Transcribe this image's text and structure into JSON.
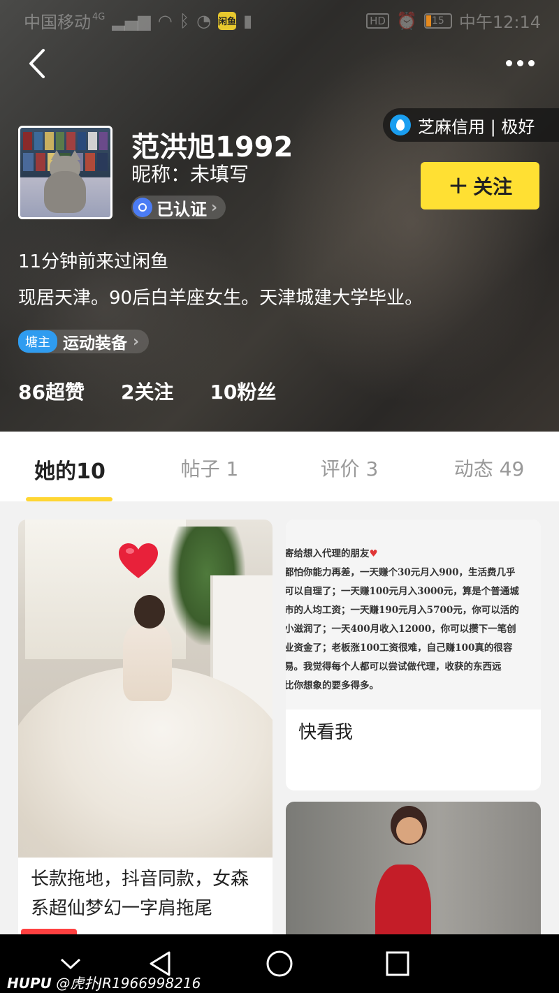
{
  "status_bar": {
    "carrier": "中国移动",
    "network": "4G",
    "app_badge": "闲鱼",
    "battery": "15",
    "time": "中午12:14"
  },
  "profile": {
    "zhima_credit": "芝麻信用 | 极好",
    "username": "范洪旭1992",
    "nickname": "昵称：未填写",
    "verified_label": "已认证",
    "follow_label": "关注",
    "last_seen": "11分钟前来过闲鱼",
    "bio": "现居天津。90后白羊座女生。天津城建大学毕业。",
    "tang_badge": "塘主",
    "tang_label": "运动装备",
    "stats": [
      "86超赞",
      "2关注",
      "10粉丝"
    ]
  },
  "tabs": [
    {
      "label": "她的10",
      "active": true
    },
    {
      "label": "帖子 1",
      "active": false
    },
    {
      "label": "评价 3",
      "active": false
    },
    {
      "label": "动态 49",
      "active": false
    }
  ],
  "items": {
    "card1_title": "长款拖地，抖音同款，女森系超仙梦幻一字肩拖尾",
    "card2_lines": [
      "寄给想入代理的朋友",
      "都怕你能力再差，一天赚个30元月入900，生活费几乎",
      "可以自理了；一天赚100元月入3000元，算是个普通城",
      "市的人均工资；一天赚190元月入5700元，你可以活的",
      "小滋润了；一天400月收入12000，你可以攒下一笔创",
      "业资金了；老板涨100工资很难，自己赚100真的很容",
      "易。我觉得每个人都可以尝试做代理，收获的东西远",
      "比你想象的要多得多。"
    ],
    "card2_title": "快看我"
  },
  "watermark": {
    "brand": "HUPU",
    "text": "@虎扑JR1966998216"
  },
  "colors": {
    "accent": "#ffe033",
    "tab_underline": "#ffd633",
    "zhima_blue": "#1a9ef0",
    "tang_blue": "#2f9cf0",
    "verified_blue": "#4b7cf5"
  },
  "icons": [
    "back-arrow-icon",
    "more-dots-icon",
    "zhima-drop-icon",
    "verified-shield-icon",
    "chevron-right-icon",
    "plus-icon",
    "heart-icon",
    "nav-back-triangle-icon",
    "nav-home-circle-icon",
    "nav-recent-square-icon",
    "nav-collapse-chevron-icon"
  ]
}
